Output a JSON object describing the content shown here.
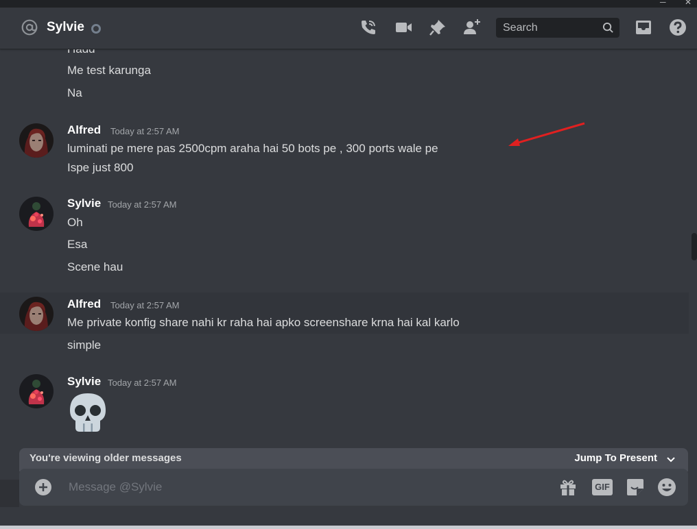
{
  "window": {
    "minimize_glyph": "─",
    "close_glyph": "✕"
  },
  "header": {
    "title": "Sylvie",
    "icons": [
      "at-icon",
      "status-offline-icon",
      "voice-call-icon",
      "video-call-icon",
      "pin-icon",
      "add-friend-icon",
      "inbox-icon",
      "help-icon"
    ],
    "search_placeholder": "Search"
  },
  "messages": {
    "continued_top": [
      "Hadd",
      "Me test karunga",
      "Na"
    ],
    "groups": [
      {
        "author": "Alfred",
        "timestamp": "Today at 2:57 AM",
        "lines": [
          "luminati pe mere pas 2500cpm araha hai 50 bots pe , 300 ports wale pe",
          "Ispe just 800"
        ]
      },
      {
        "author": "Sylvie",
        "timestamp": "Today at 2:57 AM",
        "lines": [
          "Oh",
          "Esa",
          "Scene hau"
        ]
      },
      {
        "author": "Alfred",
        "timestamp": "Today at 2:57 AM",
        "lines": [
          "Me private konfig share nahi kr raha hai apko screenshare krna hai kal karlo",
          "simple"
        ]
      },
      {
        "author": "Sylvie",
        "timestamp": "Today at 2:57 AM",
        "lines": [
          "skull-emoji"
        ]
      }
    ]
  },
  "older_bar": {
    "label": "You're viewing older messages",
    "jump_label": "Jump To Present"
  },
  "composer": {
    "placeholder": "Message @Sylvie",
    "gif_label": "GIF",
    "icons": [
      "add-attachment-icon",
      "gift-icon",
      "gif-icon",
      "sticker-icon",
      "emoji-icon"
    ]
  },
  "colors": {
    "background": "#36393f",
    "annotation_arrow": "#e02020",
    "author": "#ffffff",
    "timestamp": "#a3a6aa"
  }
}
